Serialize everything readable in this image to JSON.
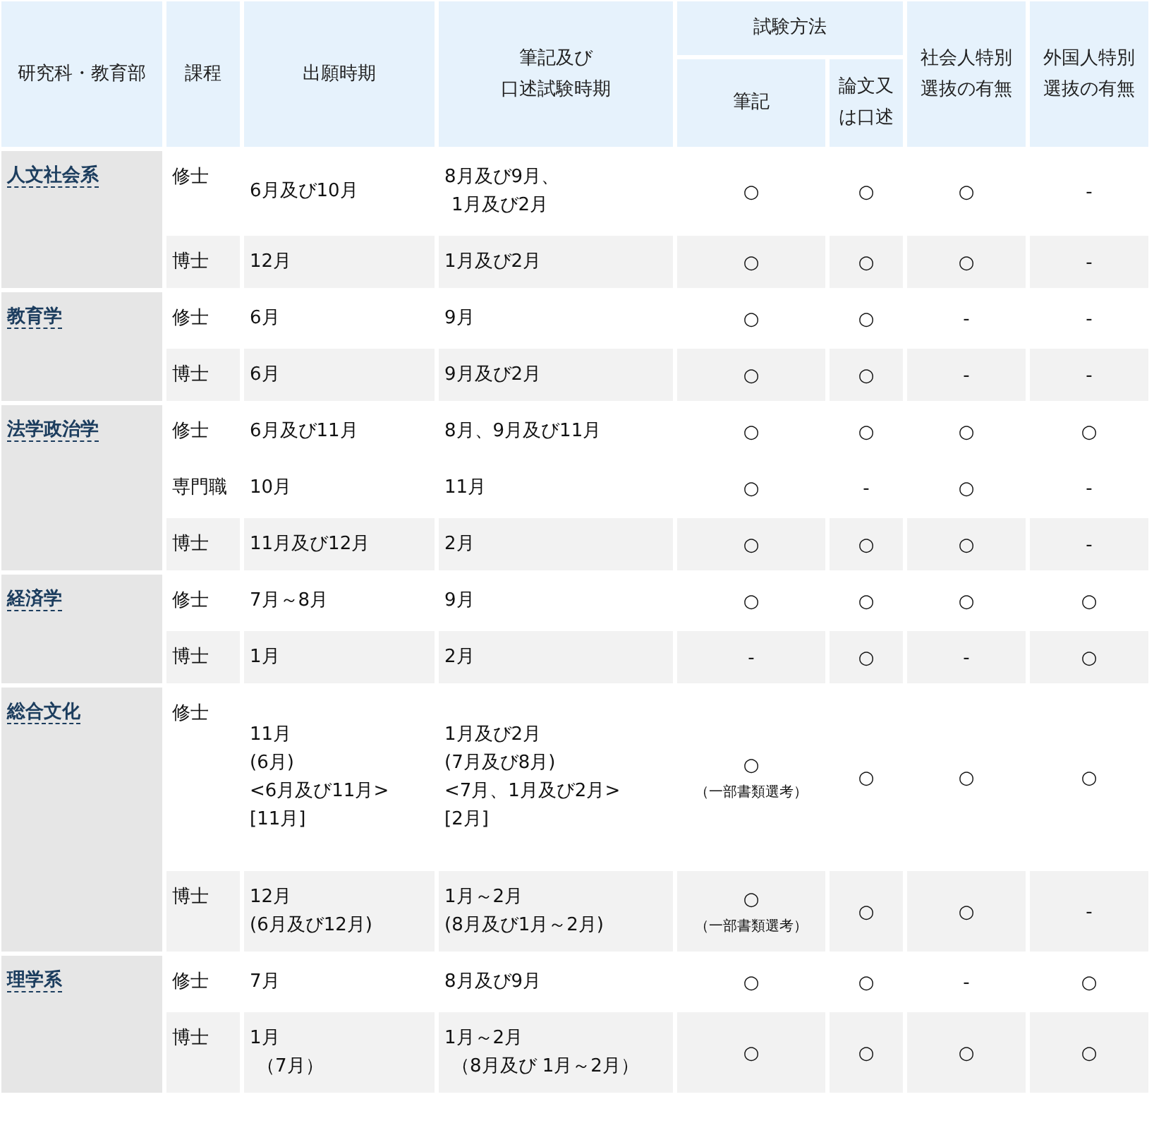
{
  "table": {
    "header": {
      "department": [
        "研究科・教育部"
      ],
      "course": [
        "課程"
      ],
      "application_period": [
        "出願時期"
      ],
      "exam_period": [
        "筆記及び",
        "口述試験時期"
      ],
      "exam_method": [
        "試験方法"
      ],
      "written": [
        "筆記"
      ],
      "thesis_or_oral": [
        "論文又",
        "は口述"
      ],
      "working_adults": [
        "社会人特別",
        "選抜の有無"
      ],
      "foreign_students": [
        "外国人特別",
        "選抜の有無"
      ]
    },
    "groups": [
      {
        "department": "人文社会系",
        "rows": [
          {
            "course": "修士",
            "application_period": [
              "6月及び10月"
            ],
            "exam_period": [
              "8月及び9月、",
              "1月及び2月"
            ],
            "written": "○",
            "thesis_or_oral": "○",
            "working_adults": "○",
            "foreign_students": "-"
          },
          {
            "course": "博士",
            "application_period": [
              "12月"
            ],
            "exam_period": [
              "1月及び2月"
            ],
            "written": "○",
            "thesis_or_oral": "○",
            "working_adults": "○",
            "foreign_students": "-"
          }
        ]
      },
      {
        "department": "教育学",
        "rows": [
          {
            "course": "修士",
            "application_period": [
              "6月"
            ],
            "exam_period": [
              "9月"
            ],
            "written": "○",
            "thesis_or_oral": "○",
            "working_adults": "-",
            "foreign_students": "-"
          },
          {
            "course": "博士",
            "application_period": [
              "6月"
            ],
            "exam_period": [
              "9月及び2月"
            ],
            "written": "○",
            "thesis_or_oral": "○",
            "working_adults": "-",
            "foreign_students": "-"
          }
        ]
      },
      {
        "department": "法学政治学",
        "rows": [
          {
            "course": "修士",
            "application_period": [
              "6月及び11月"
            ],
            "exam_period": [
              "8月、9月及び11月"
            ],
            "written": "○",
            "thesis_or_oral": "○",
            "working_adults": "○",
            "foreign_students": "○"
          },
          {
            "course": "専門職",
            "application_period": [
              "10月"
            ],
            "exam_period": [
              "11月"
            ],
            "written": "○",
            "thesis_or_oral": "-",
            "working_adults": "○",
            "foreign_students": "-"
          },
          {
            "course": "博士",
            "application_period": [
              "11月及び12月"
            ],
            "exam_period": [
              "2月"
            ],
            "written": "○",
            "thesis_or_oral": "○",
            "working_adults": "○",
            "foreign_students": "-"
          }
        ]
      },
      {
        "department": "経済学",
        "rows": [
          {
            "course": "修士",
            "application_period": [
              "7月～8月"
            ],
            "exam_period": [
              "9月"
            ],
            "written": "○",
            "thesis_or_oral": "○",
            "working_adults": "○",
            "foreign_students": "○"
          },
          {
            "course": "博士",
            "application_period": [
              "1月"
            ],
            "exam_period": [
              "2月"
            ],
            "written": "-",
            "thesis_or_oral": "○",
            "working_adults": "-",
            "foreign_students": "○"
          }
        ]
      },
      {
        "department": "総合文化",
        "rows": [
          {
            "course": "修士",
            "application_period": [
              "11月",
              "(6月)",
              "<6月及び11月>",
              "[11月]"
            ],
            "exam_period": [
              "1月及び2月",
              "(7月及び8月)",
              "<7月、1月及び2月>",
              "[2月]"
            ],
            "written": "○",
            "written_note": "（一部書類選考）",
            "thesis_or_oral": "○",
            "working_adults": "○",
            "foreign_students": "○"
          },
          {
            "course": "博士",
            "application_period": [
              "12月",
              "(6月及び12月)"
            ],
            "exam_period": [
              "1月～2月",
              "(8月及び1月～2月)"
            ],
            "written": "○",
            "written_note": "（一部書類選考）",
            "thesis_or_oral": "○",
            "working_adults": "○",
            "foreign_students": "-"
          }
        ]
      },
      {
        "department": "理学系",
        "rows": [
          {
            "course": "修士",
            "application_period": [
              "7月"
            ],
            "exam_period": [
              "8月及び9月"
            ],
            "written": "○",
            "thesis_or_oral": "○",
            "working_adults": "-",
            "foreign_students": "○"
          },
          {
            "course": "博士",
            "application_period": [
              "1月",
              "（7月）"
            ],
            "exam_period": [
              "1月～2月",
              "（8月及び 1月～2月）"
            ],
            "written": "○",
            "thesis_or_oral": "○",
            "working_adults": "○",
            "foreign_students": "○"
          }
        ]
      }
    ]
  }
}
